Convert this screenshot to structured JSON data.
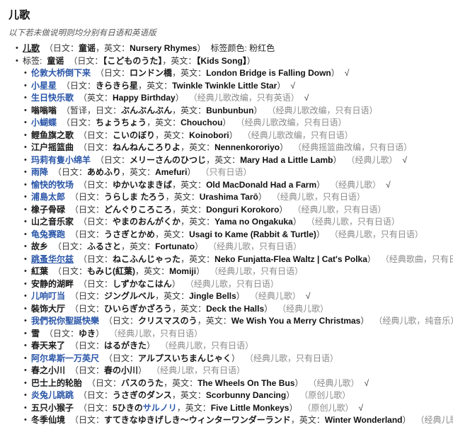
{
  "page": {
    "title": "儿歌",
    "subtitle": "以下若未做说明则均分别有日语和英语版",
    "labels": {
      "jp_prefix": "日文：",
      "en_prefix": "英文：",
      "tag_color_label": "标签颜色:",
      "tag_color_value": "粉红色",
      "tag_label": "标签:",
      "check": "√",
      "open_paren": "（",
      "close_paren": "）"
    }
  },
  "header_items": [
    {
      "name": "儿歌",
      "name_link": false,
      "name_underline": false,
      "jp": "童谣",
      "jp_underline": true,
      "en": "Nursery Rhymes",
      "trailing_label": "标签颜色: 粉红色"
    },
    {
      "prefix": "标签:",
      "name": "童谣",
      "name_link": false,
      "jp": "【こどものうた】",
      "en": "【Kids Song】"
    }
  ],
  "songs": [
    {
      "name": "伦敦大桥倒下来",
      "link": true,
      "jp": "ロンドン橋",
      "en": "London Bridge is Falling Down",
      "note": "",
      "check": true
    },
    {
      "name": "小星星",
      "link": true,
      "jp": "きらきら星",
      "en": "Twinkle Twinkle Little Star",
      "note": "",
      "check": true
    },
    {
      "name": "生日快乐歌",
      "link": true,
      "jp": "",
      "en": "Happy Birthday",
      "note": "（经典儿歌改编，只有英语）",
      "check": true
    },
    {
      "name": "嗡嗡嗡",
      "link": false,
      "name_suffix": "暂译",
      "jp": "ぶんぶんぶん",
      "en": "Bunbunbun",
      "note": "（经典儿歌改编，只有日语）",
      "check": false
    },
    {
      "name": "小蝴蝶",
      "link": true,
      "jp": "ちょうちょう",
      "en": "Chouchou",
      "note": "（经典儿歌改编，只有日语）",
      "check": false
    },
    {
      "name": "鲤鱼旗之歌",
      "link": false,
      "jp": "こいのぼり",
      "en": "Koinobori",
      "note": "（经典儿歌改编，只有日语）",
      "check": false
    },
    {
      "name": "江户摇篮曲",
      "link": false,
      "jp": "ねんねんころりよ",
      "en": "Nennenkororiyo",
      "note": "（经典摇篮曲改编，只有日语）",
      "check": false
    },
    {
      "name": "玛莉有隻小绵羊",
      "link": true,
      "jp": "メリーさんのひつじ",
      "en": "Mary Had a Little Lamb",
      "note": "（经典儿歌）",
      "check": true
    },
    {
      "name": "雨降",
      "link": true,
      "jp": "あめふり",
      "en": "Amefuri",
      "note": "（只有日语）",
      "check": false
    },
    {
      "name": "愉快的牧场",
      "link": true,
      "jp": "ゆかいなまきば",
      "en": "Old MacDonald Had a Farm",
      "note": "（经典儿歌）",
      "check": true
    },
    {
      "name": "浦島太郎",
      "link": true,
      "jp": "うらしま たろう",
      "en": "Urashima Tarō",
      "note": "（经典儿歌，只有日语）",
      "check": false
    },
    {
      "name": "橡子骨碌",
      "link": false,
      "jp": "どんぐりころころ",
      "en": "Donguri Korokoro",
      "note": "（经典儿歌，只有日语）",
      "check": false
    },
    {
      "name": "山之音乐家",
      "link": false,
      "jp": "やまのおんがくか",
      "en": "Yama no Ongakuka",
      "note": "（经典儿歌，只有日语）",
      "check": false
    },
    {
      "name": "龟兔赛跑",
      "link": true,
      "jp": "うさぎとかめ",
      "en": "Usagi to Kame (Rabbit & Turtle)",
      "note": "（经典儿歌，只有日语）",
      "check": false
    },
    {
      "name": "故乡",
      "link": false,
      "jp": "ふるさと",
      "en": "Fortunato",
      "note": "（经典儿歌，只有日语）",
      "check": false
    },
    {
      "name": "跳蚤华尔兹",
      "link": true,
      "name_underline": true,
      "jp": "ねこふんじゃった",
      "en": "Neko Funjatta-Flea Waltz | Cat's Polka",
      "note": "（经典歌曲，只有日语演唱，其他为纯音乐）",
      "check": true
    },
    {
      "name": "紅葉",
      "link": false,
      "jp": "もみじ(紅葉)",
      "jp_underline": true,
      "en": "Momiji",
      "note": "（经典儿歌，只有日语）",
      "check": false
    },
    {
      "name": "安静的湖畔",
      "link": false,
      "jp": "しずかなこはん",
      "en": "",
      "note": "（经典儿歌，只有日语）",
      "check": false
    },
    {
      "name": "儿响叮当",
      "link": true,
      "jp": "ジングルベル",
      "en": "Jingle Bells",
      "note": "（经典儿歌）",
      "check": true
    },
    {
      "name": "裝饰大厅",
      "link": false,
      "jp": "ひいらぎかざろう",
      "en": "Deck the Halls",
      "note": "（经典儿歌）",
      "check": false
    },
    {
      "name": "我們祝你聖誕快樂",
      "link": true,
      "jp": "クリスマスのう",
      "en": "We Wish You a Merry Christmas",
      "note": "（经典儿歌，纯音乐）",
      "check": false
    },
    {
      "name": "雪",
      "link": false,
      "jp": "ゆき",
      "en": "",
      "note": "（经典儿歌，只有日语）",
      "check": false
    },
    {
      "name": "春天来了",
      "link": false,
      "jp": "はるがきた",
      "en": "",
      "note": "（经典儿歌，只有日语）",
      "check": false
    },
    {
      "name": "阿尔卑斯一万英尺",
      "link": true,
      "jp": "アルプスいちまんじゃく",
      "en": "",
      "note": "（经典儿歌，只有日语）",
      "check": false
    },
    {
      "name": "春之小川",
      "link": false,
      "jp": "春の小川",
      "en": "",
      "note": "（经典儿歌，只有日语）",
      "check": false
    },
    {
      "name": "巴士上的轮胎",
      "link": false,
      "jp": "バスのうた",
      "en": "The Wheels On The Bus",
      "note": "（经典儿歌）",
      "check": true
    },
    {
      "name": "炎兔儿跳跳",
      "link": true,
      "jp": "うさぎのダンス",
      "en": "Scorbunny Dancing",
      "note": "（原创儿歌）",
      "check": false
    },
    {
      "name": "五只小猴子",
      "link": false,
      "jp": "5ひきの",
      "jp_link_tail": "サルノリ",
      "en": "Five Little Monkeys",
      "note": "（原创儿歌）",
      "check": true
    },
    {
      "name": "冬季仙境",
      "link": false,
      "jp": "すてきなゆきげしき〜ウィンターワンダーランド",
      "en": "Winter Wonderland",
      "note": "（经典儿歌）",
      "check": true
    }
  ]
}
